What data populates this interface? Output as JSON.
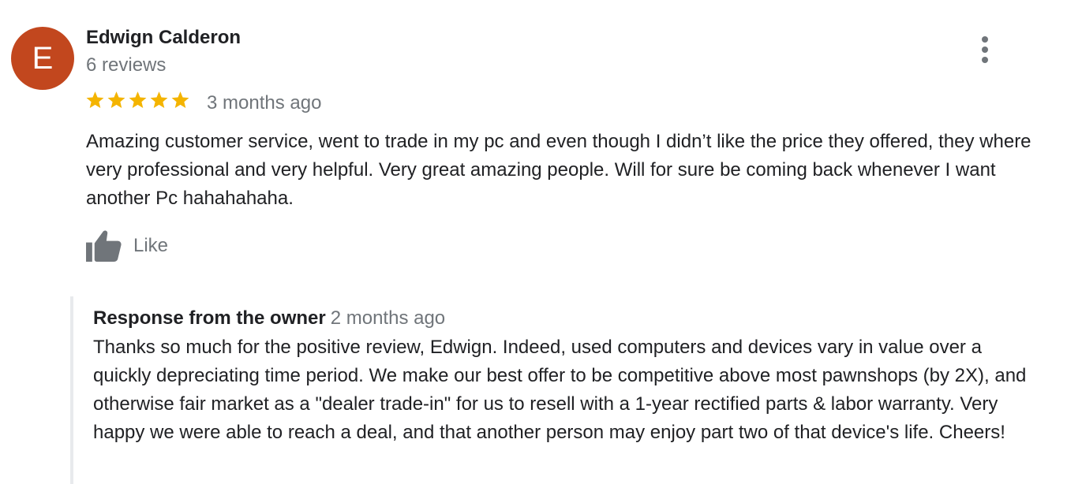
{
  "review": {
    "avatar_letter": "E",
    "avatar_color": "#c2471e",
    "reviewer_name": "Edwign Calderon",
    "review_count": "6 reviews",
    "rating": 5,
    "rating_max": 5,
    "star_color": "#f4b400",
    "date": "3 months ago",
    "text": "Amazing customer service, went to trade in my pc and even though I didn’t like the price they offered, they where very professional and very helpful. Very great amazing people. Will for sure be coming back whenever I want another Pc hahahahaha.",
    "like_label": "Like",
    "icons": {
      "more": "more-vert-icon",
      "like": "thumbs-up-icon",
      "star": "star-icon"
    }
  },
  "owner_response": {
    "title": "Response from the owner",
    "date": "2 months ago",
    "text": "Thanks so much for the positive review, Edwign. Indeed, used computers and devices vary in value over a quickly depreciating time period. We make our best offer to be competitive above most pawnshops (by 2X), and otherwise fair market as a \"dealer trade-in\" for us to resell with a 1-year rectified parts & labor warranty. Very happy we were able to reach a deal, and that another person may enjoy part two of that device's life. Cheers!"
  }
}
